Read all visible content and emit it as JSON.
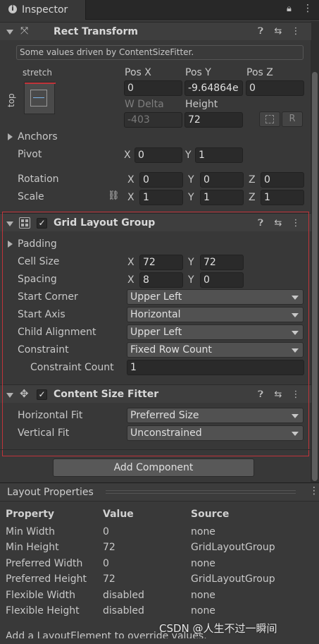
{
  "tab": {
    "title": "Inspector"
  },
  "rect_transform": {
    "title": "Rect Transform",
    "info": "Some values driven by ContentSizeFitter.",
    "anchor_h": "stretch",
    "anchor_v": "top",
    "pos_x_label": "Pos X",
    "pos_y_label": "Pos Y",
    "pos_z_label": "Pos Z",
    "pos_x": "0",
    "pos_y": "-9.64864e",
    "pos_z": "0",
    "w_delta_label": "W Delta",
    "height_label": "Height",
    "w_delta": "-403",
    "height": "72",
    "r_button": "R",
    "anchors_label": "Anchors",
    "pivot_label": "Pivot",
    "pivot_x": "0",
    "pivot_y": "1",
    "rotation_label": "Rotation",
    "rot_x": "0",
    "rot_y": "0",
    "rot_z": "0",
    "scale_label": "Scale",
    "scale_x": "1",
    "scale_y": "1",
    "scale_z": "1"
  },
  "axis": {
    "x": "X",
    "y": "Y",
    "z": "Z"
  },
  "grid_layout": {
    "title": "Grid Layout Group",
    "padding_label": "Padding",
    "cell_size_label": "Cell Size",
    "cell_x": "72",
    "cell_y": "72",
    "spacing_label": "Spacing",
    "spacing_x": "8",
    "spacing_y": "0",
    "start_corner_label": "Start Corner",
    "start_corner": "Upper Left",
    "start_axis_label": "Start Axis",
    "start_axis": "Horizontal",
    "child_alignment_label": "Child Alignment",
    "child_alignment": "Upper Left",
    "constraint_label": "Constraint",
    "constraint": "Fixed Row Count",
    "constraint_count_label": "Constraint Count",
    "constraint_count": "1"
  },
  "content_size_fitter": {
    "title": "Content Size Fitter",
    "horizontal_fit_label": "Horizontal Fit",
    "horizontal_fit": "Preferred Size",
    "vertical_fit_label": "Vertical Fit",
    "vertical_fit": "Unconstrained"
  },
  "add_component": "Add Component",
  "layout_properties": {
    "title": "Layout Properties",
    "headers": {
      "property": "Property",
      "value": "Value",
      "source": "Source"
    },
    "rows": [
      {
        "property": "Min Width",
        "value": "0",
        "source": "none"
      },
      {
        "property": "Min Height",
        "value": "72",
        "source": "GridLayoutGroup"
      },
      {
        "property": "Preferred Width",
        "value": "0",
        "source": "none"
      },
      {
        "property": "Preferred Height",
        "value": "72",
        "source": "GridLayoutGroup"
      },
      {
        "property": "Flexible Width",
        "value": "disabled",
        "source": "none"
      },
      {
        "property": "Flexible Height",
        "value": "disabled",
        "source": "none"
      }
    ],
    "footer": "Add a LayoutElement to override values."
  },
  "watermark": "CSDN @人生不过一瞬间",
  "colors": {
    "highlight": "#c0343a",
    "panel": "#383838",
    "header": "#3e3e3e"
  }
}
